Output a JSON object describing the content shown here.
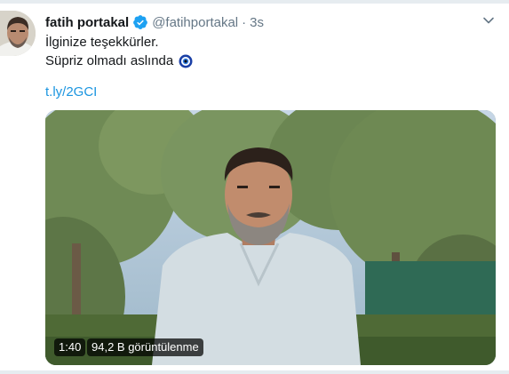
{
  "tweet": {
    "author_name": "fatih portakal",
    "handle": "@fatihportakal",
    "separator": "·",
    "time": "3s",
    "text_line1": "İlginize teşekkürler.",
    "text_line2": "Süpriz olmadı aslında",
    "link": "t.ly/2GCI",
    "emoji": "nazar-amulet-icon"
  },
  "video": {
    "duration": "1:40",
    "views": "94,2 B görüntülenme"
  },
  "colors": {
    "link": "#1b95e0",
    "verified": "#1da1f2",
    "muted": "#657786",
    "text": "#14171a",
    "background": "#e6ecf0"
  }
}
